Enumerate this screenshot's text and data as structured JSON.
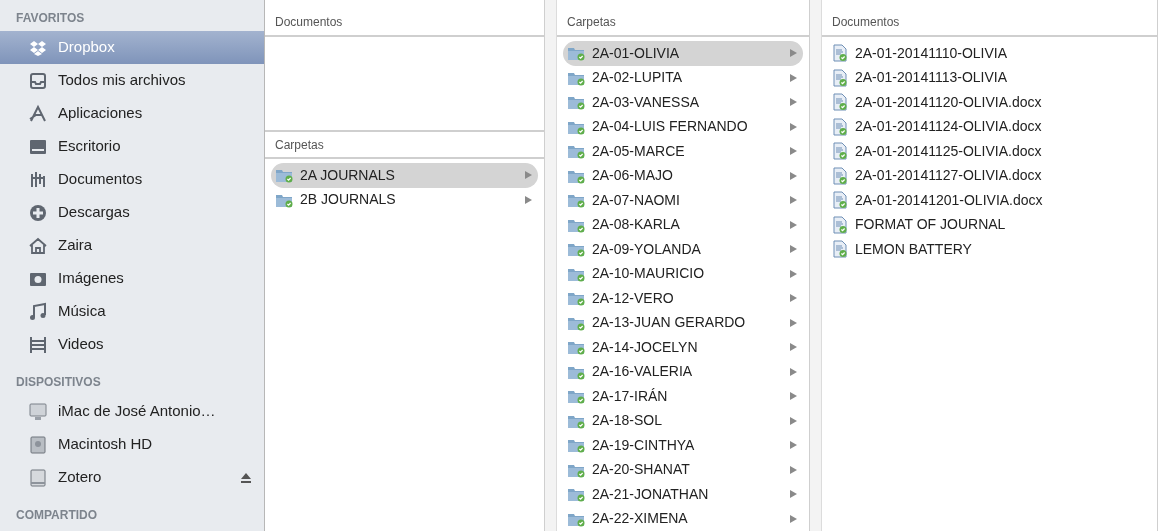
{
  "sidebar": {
    "sections": [
      {
        "title": "FAVORITOS",
        "items": [
          {
            "label": "Dropbox",
            "kind": "dropbox",
            "selected": true
          },
          {
            "label": "Todos mis archivos",
            "kind": "tray",
            "selected": false
          },
          {
            "label": "Aplicaciones",
            "kind": "apps",
            "selected": false
          },
          {
            "label": "Escritorio",
            "kind": "desktop",
            "selected": false
          },
          {
            "label": "Documentos",
            "kind": "documents",
            "selected": false
          },
          {
            "label": "Descargas",
            "kind": "download",
            "selected": false
          },
          {
            "label": "Zaira",
            "kind": "home",
            "selected": false
          },
          {
            "label": "Imágenes",
            "kind": "camera",
            "selected": false
          },
          {
            "label": "Música",
            "kind": "music",
            "selected": false
          },
          {
            "label": "Videos",
            "kind": "film",
            "selected": false
          }
        ]
      },
      {
        "title": "DISPOSITIVOS",
        "items": [
          {
            "label": "iMac de José Antonio…",
            "kind": "imac",
            "selected": false,
            "ejectable": false
          },
          {
            "label": "Macintosh HD",
            "kind": "disk",
            "selected": false,
            "ejectable": false
          },
          {
            "label": "Zotero",
            "kind": "drive",
            "selected": false,
            "ejectable": true
          }
        ]
      },
      {
        "title": "COMPARTIDO"
      }
    ]
  },
  "columns": [
    {
      "sections": [
        {
          "header": "Documentos"
        },
        {
          "header": "Carpetas",
          "items": [
            {
              "name": "2A JOURNALS",
              "kind": "folder",
              "selected": true
            },
            {
              "name": "2B JOURNALS",
              "kind": "folder",
              "selected": false
            }
          ]
        }
      ]
    },
    {
      "sections": [
        {
          "header": "Carpetas",
          "items": [
            {
              "name": "2A-01-OLIVIA",
              "kind": "folder",
              "selected": true
            },
            {
              "name": "2A-02-LUPITA",
              "kind": "folder",
              "selected": false
            },
            {
              "name": "2A-03-VANESSA",
              "kind": "folder",
              "selected": false
            },
            {
              "name": "2A-04-LUIS FERNANDO",
              "kind": "folder",
              "selected": false
            },
            {
              "name": "2A-05-MARCE",
              "kind": "folder",
              "selected": false
            },
            {
              "name": "2A-06-MAJO",
              "kind": "folder",
              "selected": false
            },
            {
              "name": "2A-07-NAOMI",
              "kind": "folder",
              "selected": false
            },
            {
              "name": "2A-08-KARLA",
              "kind": "folder",
              "selected": false
            },
            {
              "name": "2A-09-YOLANDA",
              "kind": "folder",
              "selected": false
            },
            {
              "name": "2A-10-MAURICIO",
              "kind": "folder",
              "selected": false
            },
            {
              "name": "2A-12-VERO",
              "kind": "folder",
              "selected": false
            },
            {
              "name": "2A-13-JUAN GERARDO",
              "kind": "folder",
              "selected": false
            },
            {
              "name": "2A-14-JOCELYN",
              "kind": "folder",
              "selected": false
            },
            {
              "name": "2A-16-VALERIA",
              "kind": "folder",
              "selected": false
            },
            {
              "name": "2A-17-IRÁN",
              "kind": "folder",
              "selected": false
            },
            {
              "name": "2A-18-SOL",
              "kind": "folder",
              "selected": false
            },
            {
              "name": "2A-19-CINTHYA",
              "kind": "folder",
              "selected": false
            },
            {
              "name": "2A-20-SHANAT",
              "kind": "folder",
              "selected": false
            },
            {
              "name": "2A-21-JONATHAN",
              "kind": "folder",
              "selected": false
            },
            {
              "name": "2A-22-XIMENA",
              "kind": "folder",
              "selected": false
            }
          ]
        }
      ]
    },
    {
      "sections": [
        {
          "header": "Documentos",
          "items": [
            {
              "name": "2A-01-20141110-OLIVIA",
              "kind": "document",
              "selected": false
            },
            {
              "name": "2A-01-20141113-OLIVIA",
              "kind": "document",
              "selected": false
            },
            {
              "name": "2A-01-20141120-OLIVIA.docx",
              "kind": "document",
              "selected": false
            },
            {
              "name": "2A-01-20141124-OLIVIA.docx",
              "kind": "document",
              "selected": false
            },
            {
              "name": "2A-01-20141125-OLIVIA.docx",
              "kind": "document",
              "selected": false
            },
            {
              "name": "2A-01-20141127-OLIVIA.docx",
              "kind": "document",
              "selected": false
            },
            {
              "name": "2A-01-20141201-OLIVIA.docx",
              "kind": "document",
              "selected": false
            },
            {
              "name": "FORMAT OF JOURNAL",
              "kind": "document",
              "selected": false
            },
            {
              "name": "LEMON BATTERY",
              "kind": "document",
              "selected": false
            }
          ]
        }
      ]
    }
  ]
}
